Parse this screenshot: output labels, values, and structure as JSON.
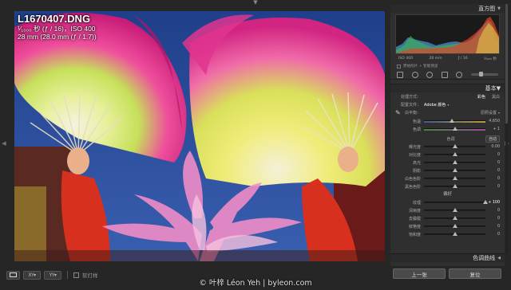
{
  "photo": {
    "filename": "L1670407.DNG",
    "exposure_line": "¹⁄₁₀₀₀ 秒 (ƒ / 16)，ISO 400",
    "lens_line": "28 mm (28.0 mm (ƒ / 1.7))"
  },
  "panel": {
    "histogram_title": "直方图",
    "exif": {
      "iso": "ISO 400",
      "focal": "28 mm",
      "aperture": "ƒ / 16",
      "shutter": "¹⁄₁₀₀₀ 秒"
    },
    "preview_label": "原始照片 + 智能预览",
    "basic_title": "基本",
    "treatment_label": "处理方式：",
    "treatment_options": [
      "彩色",
      "黑白"
    ],
    "profile_label": "配置文件：",
    "profile_value": "Adobe 颜色",
    "wb_label": "白平衡：",
    "wb_value": "原照设置",
    "temp_label": "色温",
    "temp_value": "4,650",
    "tint_label": "色调",
    "tint_value": "+ 1",
    "tone_label": "色调",
    "auto_label": "自动",
    "exposure_label": "曝光度",
    "exposure_value": "0.00",
    "contrast_label": "对比度",
    "contrast_value": "0",
    "highlights_label": "高光",
    "highlights_value": "0",
    "shadows_label": "阴影",
    "shadows_value": "0",
    "whites_label": "白色色阶",
    "whites_value": "0",
    "blacks_label": "黑色色阶",
    "blacks_value": "0",
    "presence_label": "偏好",
    "texture_label": "纹理",
    "texture_value": "+ 100",
    "clarity_label": "清晰度",
    "clarity_value": "0",
    "dehaze_label": "去朦胧",
    "dehaze_value": "0",
    "vibrance_label": "鲜艳度",
    "vibrance_value": "0",
    "saturation_label": "饱和度",
    "saturation_value": "0",
    "tone_curve_title": "色调曲线"
  },
  "toolbar": {
    "view_icon": "loupe-view-icon",
    "compare_icon": "compare-view-icon",
    "survey_icon": "survey-view-icon",
    "soft_proof_label": "软打样"
  },
  "buttons": {
    "previous": "上一张",
    "reset": "复位"
  },
  "credit": "© 叶梓 Léon Yeh | byleon.com"
}
